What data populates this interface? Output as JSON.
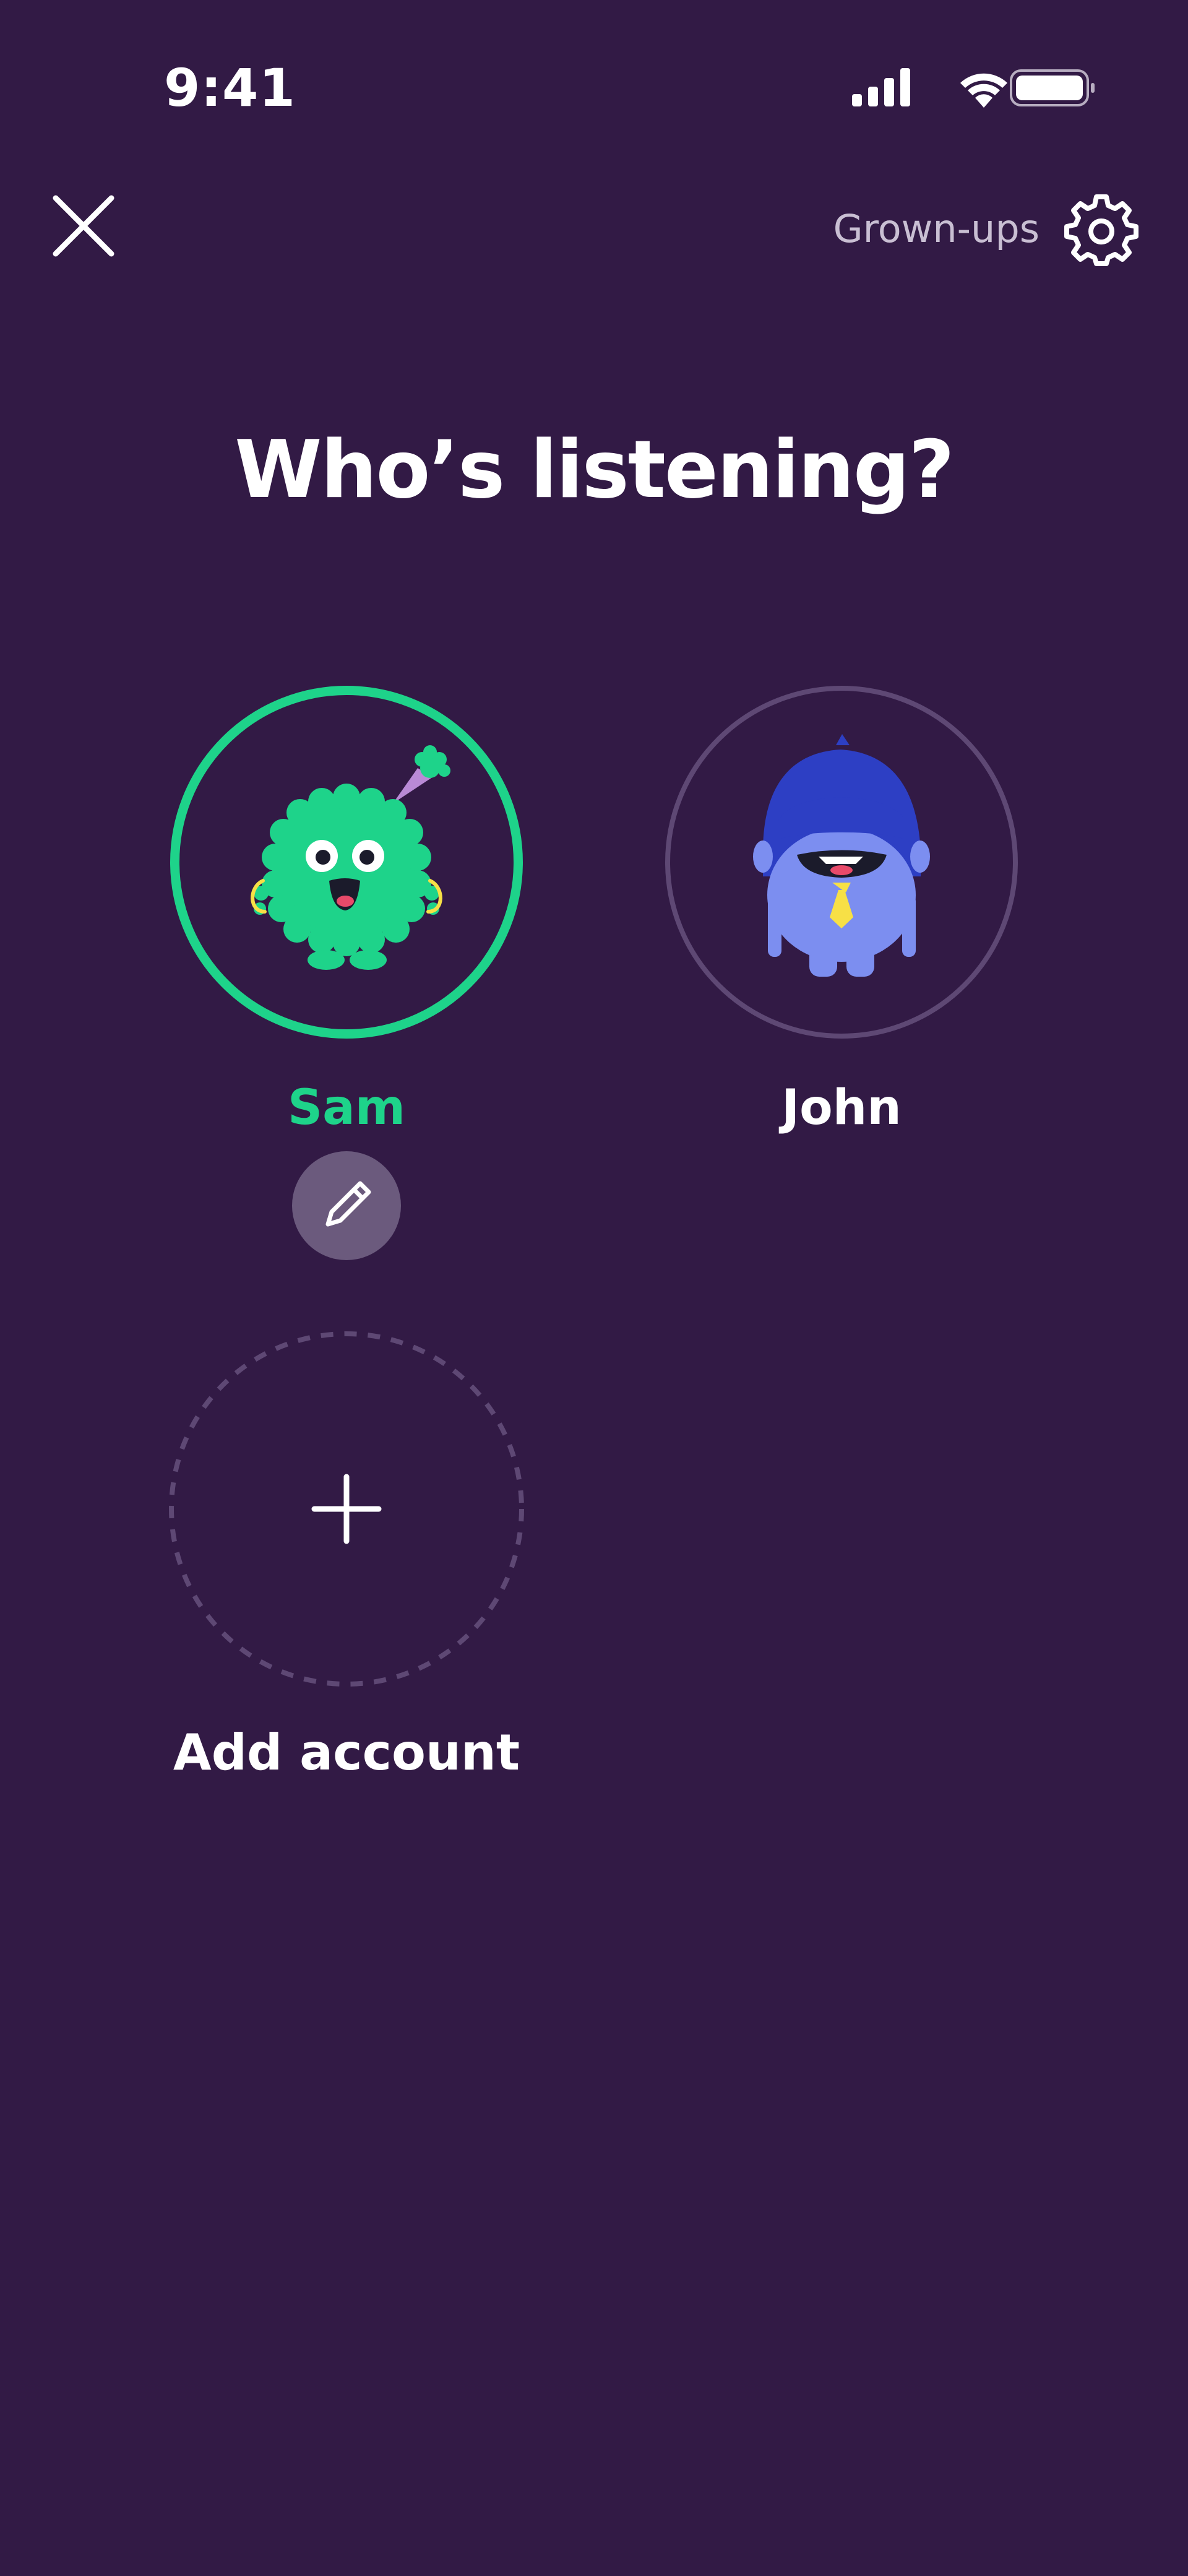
{
  "status_bar": {
    "time": "9:41"
  },
  "header": {
    "close_icon": "close-icon",
    "grownups_label": "Grown-ups",
    "settings_icon": "gear-icon"
  },
  "title": "Who’s listening?",
  "profiles": [
    {
      "name": "Sam",
      "selected": true,
      "avatar": "green-monster-avatar"
    },
    {
      "name": "John",
      "selected": false,
      "avatar": "blue-monster-avatar"
    }
  ],
  "edit_icon": "pencil-icon",
  "add_account": {
    "label": "Add account",
    "icon": "plus-icon"
  },
  "colors": {
    "background": "#321a45",
    "accent": "#1ed38a",
    "muted_ring": "#5e4874",
    "edit_button": "#6b5a7d"
  }
}
